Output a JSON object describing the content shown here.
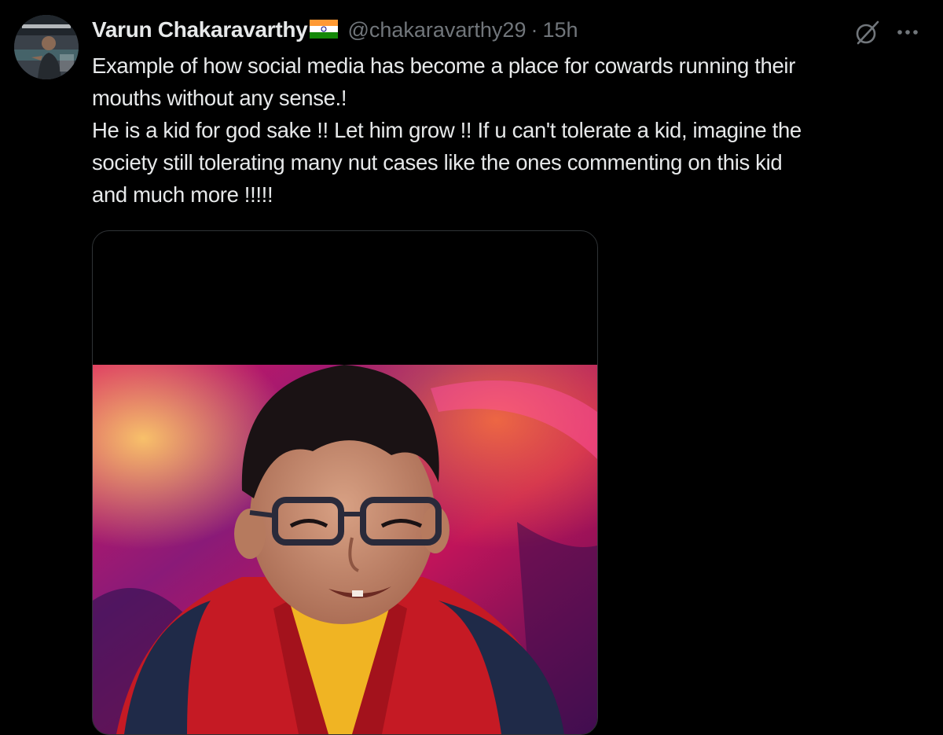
{
  "tweet": {
    "author": {
      "display_name": "Varun Chakaravarthy",
      "handle": "@chakaravarthy29",
      "separator": "·",
      "timestamp": "15h",
      "avatar": "profile-photo",
      "country_flag": "india-flag-emoji"
    },
    "text_lines": [
      "Example of how social media has become a place for cowards running their",
      "mouths without any sense.!",
      "He is a kid for god sake !! Let him grow !! If u can't tolerate a kid, imagine the",
      "society still tolerating many nut cases like the ones commenting on this kid",
      "and much more !!!!!"
    ],
    "actions": {
      "grok_icon": "grok-icon",
      "more_icon": "more-dots-icon"
    },
    "media": {
      "type": "video-thumbnail",
      "description_icon": "photo"
    }
  },
  "colors": {
    "background": "#000000",
    "text_primary": "#e7e9ea",
    "text_secondary": "#71767b",
    "border": "#2f3336"
  }
}
